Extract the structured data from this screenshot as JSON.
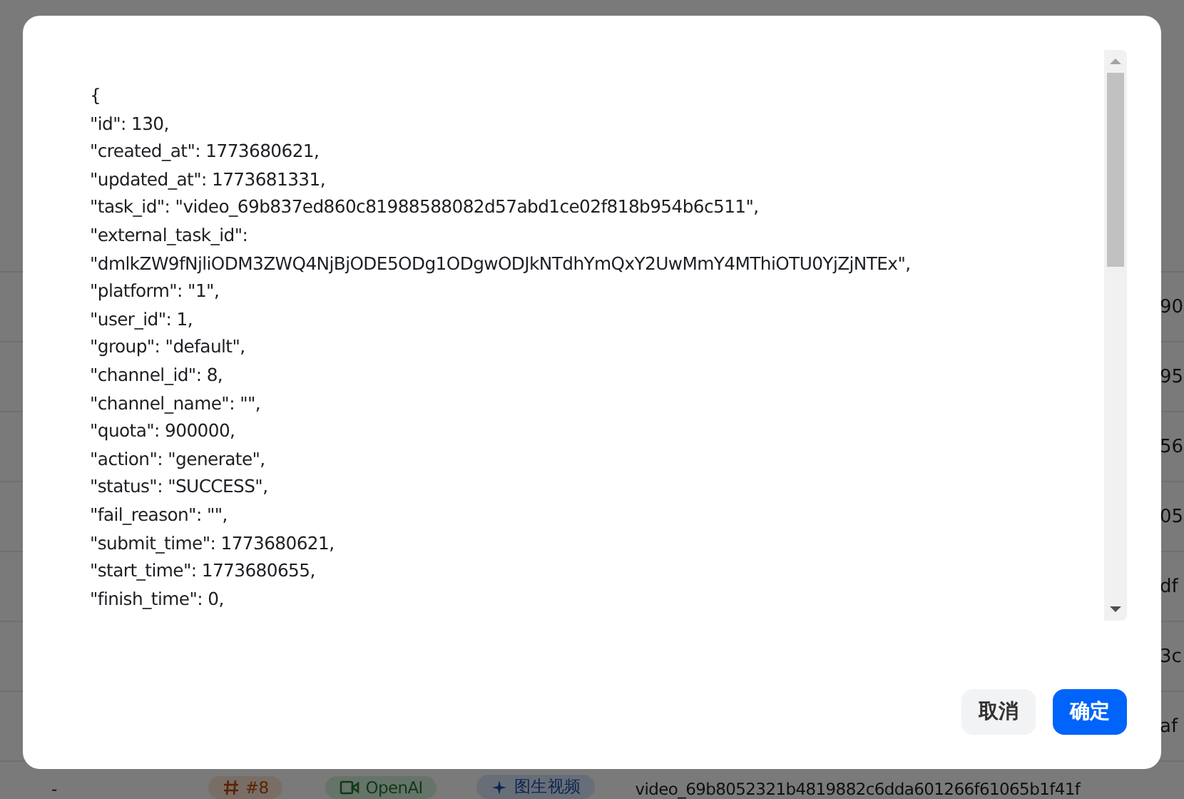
{
  "background_table": {
    "rows": [
      {
        "cell": "90"
      },
      {
        "cell": "95"
      },
      {
        "cell": "56"
      },
      {
        "cell": "05"
      },
      {
        "cell": "df"
      },
      {
        "cell": "3c"
      },
      {
        "cell": "af"
      }
    ],
    "last_row": {
      "id": "-",
      "channel": "#8",
      "platform": "OpenAI",
      "type": "图生视频",
      "task_id": "video_69b8052321b4819882c6dda601266f61065b1f41f"
    }
  },
  "dialog": {
    "lines": [
      "{",
      "\"id\": 130,",
      "\"created_at\": 1773680621,",
      "\"updated_at\": 1773681331,",
      "\"task_id\": \"video_69b837ed860c81988588082d57abd1ce02f818b954b6c511\",",
      "\"external_task_id\":",
      "\"dmlkZW9fNjliODM3ZWQ4NjBjODE5ODg1ODgwODJkNTdhYmQxY2UwMmY4MThiOTU0YjZjNTEx\",",
      "\"platform\": \"1\",",
      "\"user_id\": 1,",
      "\"group\": \"default\",",
      "\"channel_id\": 8,",
      "\"channel_name\": \"\",",
      "\"quota\": 900000,",
      "\"action\": \"generate\",",
      "\"status\": \"SUCCESS\",",
      "\"fail_reason\": \"\",",
      "\"submit_time\": 1773680621,",
      "\"start_time\": 1773680655,",
      "\"finish_time\": 0,"
    ],
    "buttons": [
      {
        "label": "取消",
        "kind": "secondary"
      },
      {
        "label": "确定",
        "kind": "primary"
      }
    ]
  }
}
